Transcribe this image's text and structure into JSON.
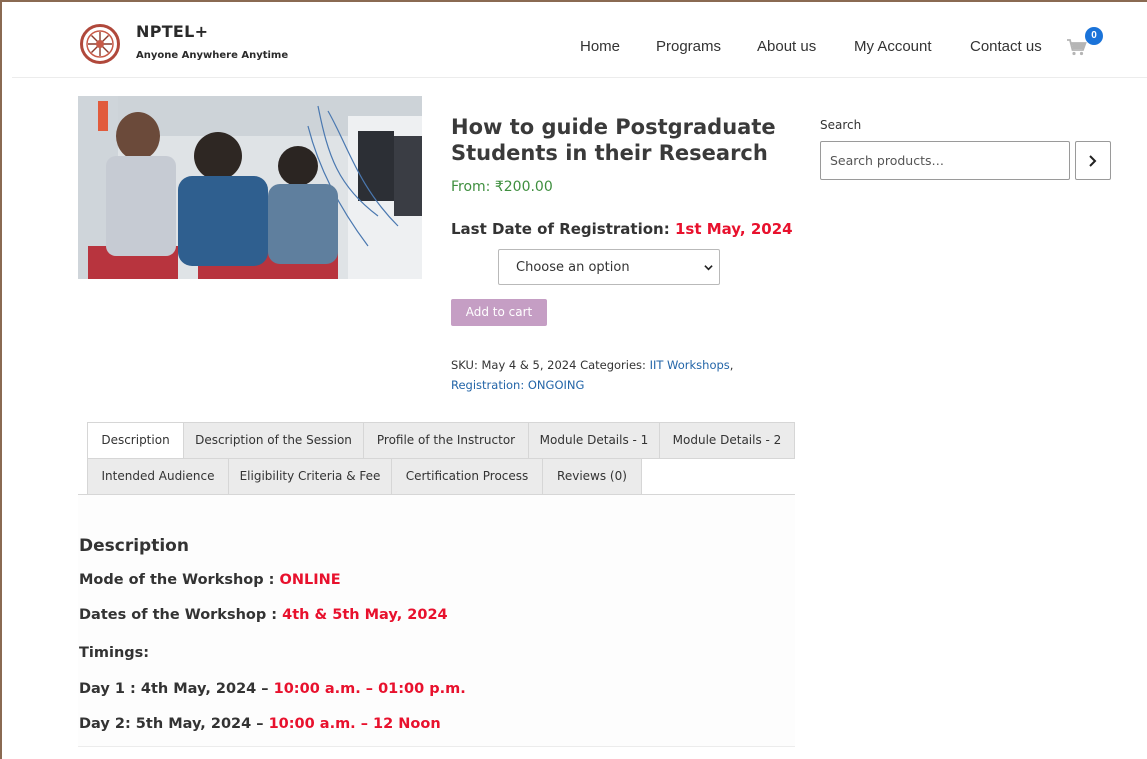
{
  "header": {
    "brand_title": "NPTEL+",
    "brand_tagline": "Anyone Anywhere Anytime",
    "nav": [
      "Home",
      "Programs",
      "About us",
      "My Account",
      "Contact us"
    ],
    "cart_count": "0"
  },
  "product": {
    "title": "How to guide Postgraduate Students in their Research",
    "price": "From: ₹200.00",
    "last_date_label": "Last Date of Registration:",
    "last_date_value": "1st May, 2024",
    "option_select": "Choose an option",
    "add_to_cart": "Add to cart",
    "meta": {
      "sku_label": "SKU:",
      "sku_value": "May 4 & 5, 2024",
      "categories_label": "Categories:",
      "category_1": "IIT Workshops",
      "separator": ",",
      "category_2": "Registration: ONGOING"
    }
  },
  "search": {
    "label": "Search",
    "placeholder": "Search products…"
  },
  "tabs": [
    "Description",
    "Description of the Session",
    "Profile of the Instructor",
    "Module Details - 1",
    "Module Details - 2",
    "Intended Audience",
    "Eligibility Criteria & Fee",
    "Certification Process",
    "Reviews (0)"
  ],
  "description": {
    "heading": "Description",
    "mode_label": "Mode of the Workshop :",
    "mode_value": "ONLINE",
    "dates_label": "Dates of the Workshop :",
    "dates_value": "4th & 5th May, 2024",
    "timings_label": "Timings:",
    "day1_label": "Day 1 : 4th May, 2024 –",
    "day1_value": "10:00 a.m. – 01:00 p.m.",
    "day2_label": "Day 2: 5th May, 2024 –",
    "day2_value": "10:00 a.m. – 12 Noon"
  },
  "colors": {
    "accent_red": "#e8112d",
    "price_green": "#3f8f3f",
    "link_blue": "#2365a8",
    "button_purple": "#c59ec4",
    "badge_blue": "#1a73d9"
  }
}
